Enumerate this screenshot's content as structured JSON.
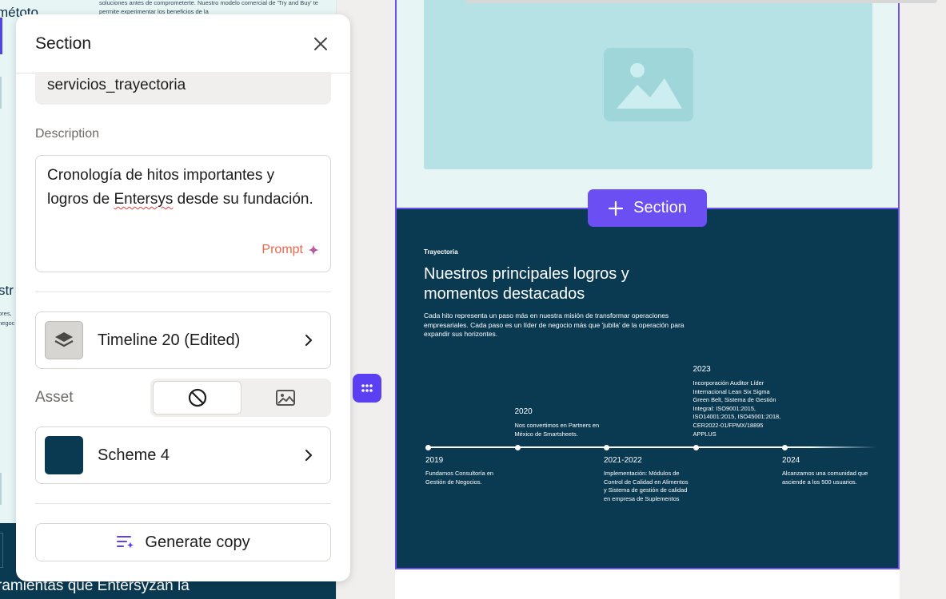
{
  "background_page": {
    "fragment_title": "métoto",
    "fragment_small": "soluciones antes de comprometerte. Nuestro modelo comercial de 'Try and Buy' te permite experimentar los beneficios de la",
    "fragment_str": "str",
    "fragment_ores": "ores,\nnegoc",
    "fragment_bottom": "ramientas que Entersyzan la"
  },
  "panel": {
    "title": "Section",
    "name_value": "servicios_trayectoria",
    "description_label": "Description",
    "description_before": "Cronología de hitos importantes y logros de ",
    "description_misspelled": "Entersys",
    "description_after": " desde su fundación.",
    "prompt_label": "Prompt",
    "layout_card_label": "Timeline 20 (Edited)",
    "asset_label": "Asset",
    "scheme_card_label": "Scheme 4",
    "scheme_color": "#0a3a52",
    "generate_label": "Generate copy",
    "icons": {
      "close": "close-icon",
      "prompt": "sparkle-icon",
      "layout": "layers-icon",
      "asset_none": "no-image-icon",
      "asset_image": "image-icon",
      "generate": "generate-text-icon",
      "chevron": "chevron-right-icon"
    }
  },
  "canvas": {
    "add_section_label": "Section",
    "accent_color": "#6b4ff2",
    "timeline": {
      "eyebrow": "Trayectoria",
      "heading": "Nuestros principales logros y momentos destacados",
      "intro": "Cada hito representa un paso más en nuestra misión de transformar operaciones empresariales. Cada paso es un líder de negocio más que 'jubila' de la operación para expandir sus horizontes.",
      "milestones": [
        {
          "year": "2019",
          "text": "Fundamos Consultoría en Gestión de Negocios."
        },
        {
          "year": "2020",
          "text": "Nos convertimos en Partners en México de Smartsheets."
        },
        {
          "year": "2021-2022",
          "text": "Implementación: Módulos de Control de Calidad en Alimentos y Sistema de gestión de calidad en empresa de Suplementos"
        },
        {
          "year": "2023",
          "text": "Incorporación Auditor Líder Internacional Lean Six Sigma Green Belt, Sistema de Gestión Integral: ISO9001:2015, ISO14001:2015, ISO45001:2018, CER2022-01/FPMX/18895 APPLUS"
        },
        {
          "year": "2024",
          "text": "Alcanzamos una comunidad que asciende a los 500 usuarios."
        }
      ]
    }
  }
}
